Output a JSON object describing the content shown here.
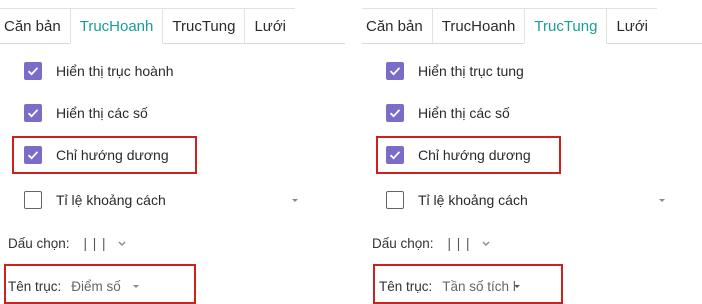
{
  "left": {
    "tabs": [
      "Căn bản",
      "TrucHoanh",
      "TrucTung",
      "Lưới"
    ],
    "active_tab": 1,
    "checkboxes": [
      {
        "label": "Hiển thị trục hoành",
        "checked": true
      },
      {
        "label": "Hiển thị các số",
        "checked": true
      },
      {
        "label": "Chỉ hướng dương",
        "checked": true
      },
      {
        "label": "Tỉ lệ khoảng cách",
        "checked": false
      }
    ],
    "tick_style": {
      "label": "Dấu chọn:",
      "value": "| | |"
    },
    "axis_name": {
      "label": "Tên trục:",
      "value": "Điểm số"
    }
  },
  "right": {
    "tabs": [
      "Căn bản",
      "TrucHoanh",
      "TrucTung",
      "Lưới"
    ],
    "active_tab": 2,
    "checkboxes": [
      {
        "label": "Hiển thị trục tung",
        "checked": true
      },
      {
        "label": "Hiển thị các số",
        "checked": true
      },
      {
        "label": "Chỉ hướng dương",
        "checked": true
      },
      {
        "label": "Tỉ lệ khoảng cách",
        "checked": false
      }
    ],
    "tick_style": {
      "label": "Dấu chọn:",
      "value": "| | |"
    },
    "axis_name": {
      "label": "Tên trục:",
      "value": "Tần số tích l"
    }
  },
  "colors": {
    "accent": "#1a9c9a",
    "checkbox": "#7b6cc7",
    "highlight": "#c9221f"
  },
  "icons": {
    "checked": "check-icon",
    "dropdown": "chevron-down-icon"
  }
}
